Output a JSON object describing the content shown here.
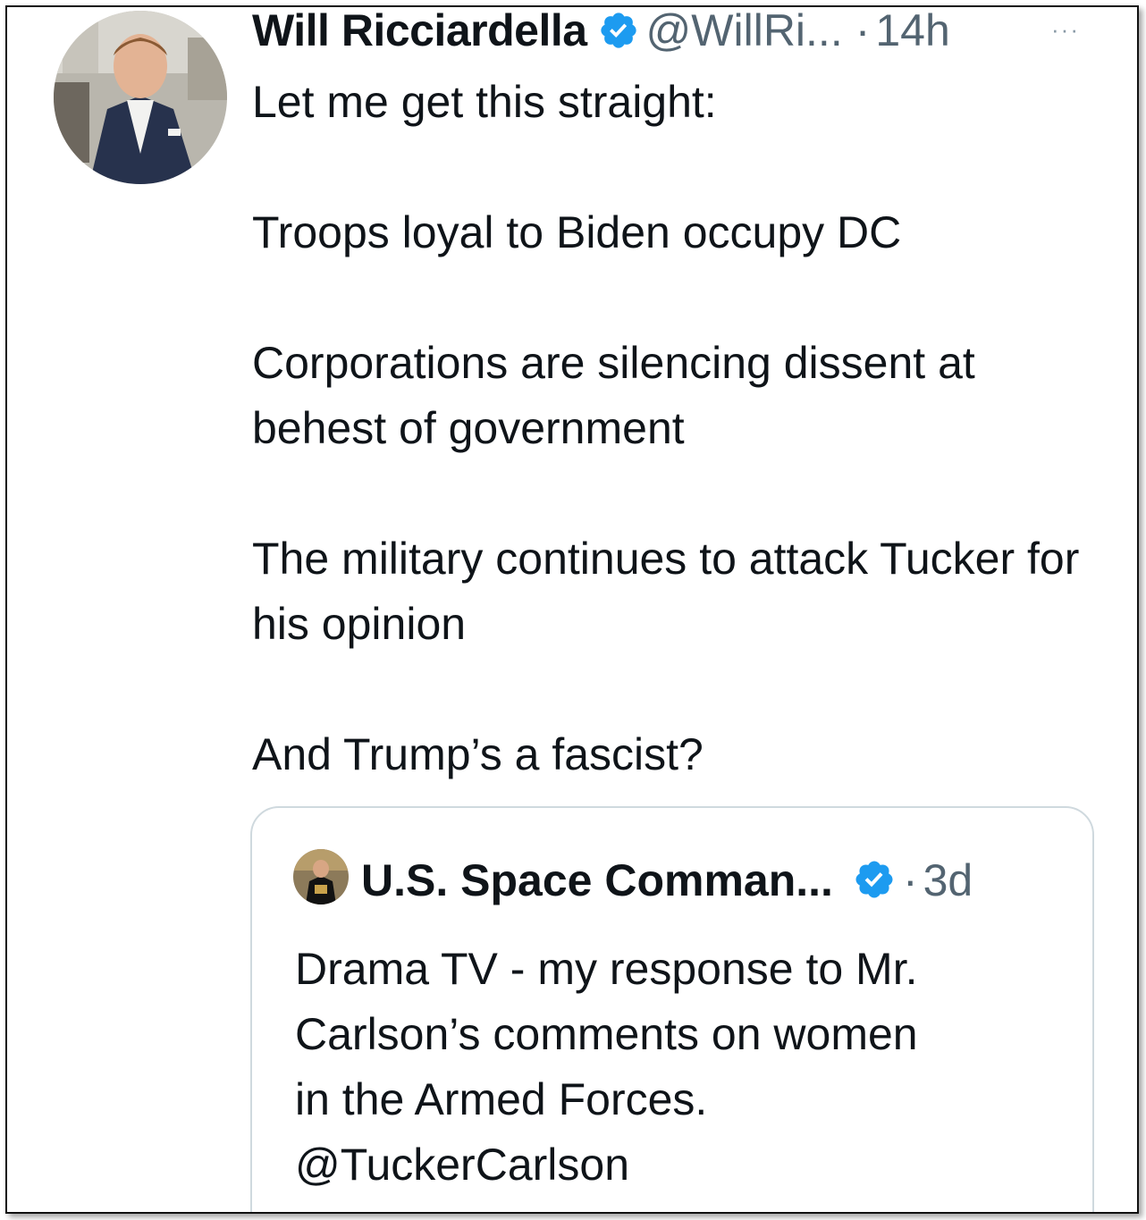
{
  "tweet": {
    "author_name": "Will Ricciardella",
    "author_handle": "@WillRi...",
    "separator": "·",
    "time": "14h",
    "more": "···",
    "paragraphs": [
      "Let me get this straight:",
      "Troops loyal to Biden occupy DC",
      "Corporations are silencing dissent at behest of government",
      "The military continues to attack Tucker for his opinion",
      "And Trump’s a fascist?"
    ]
  },
  "quoted_tweet": {
    "author_name": "U.S. Space Comman...",
    "separator": "·",
    "time": "3d",
    "lines": [
      "Drama TV - my response to Mr.",
      "Carlson’s comments on women",
      "in the Armed Forces.",
      "@TuckerCarlson"
    ]
  },
  "colors": {
    "verified_badge": "#1d9bf0",
    "secondary_text": "#536471",
    "primary_text": "#0f1419",
    "card_border": "#cfd9de"
  },
  "icons": {
    "verified": "verified-badge-icon",
    "more": "more-dots-icon"
  }
}
